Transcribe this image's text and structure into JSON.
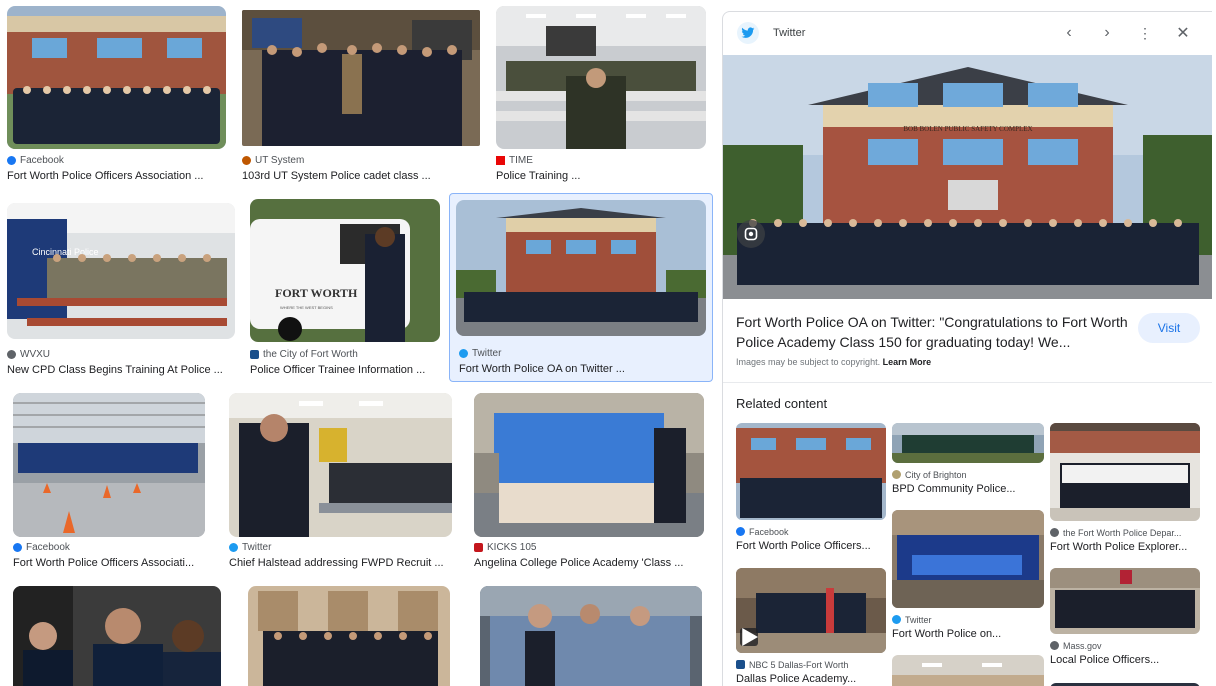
{
  "results": [
    {
      "source": "Facebook",
      "title": "Fort Worth Police Officers Association ...",
      "icon": "facebook-icon",
      "color": "#1877f2"
    },
    {
      "source": "UT System",
      "title": "103rd UT System Police cadet class ...",
      "icon": "ut-system-icon",
      "color": "#bf5700"
    },
    {
      "source": "TIME",
      "title": "Police Training ...",
      "icon": "time-icon",
      "color": "#e90606"
    },
    {
      "source": "WVXU",
      "title": "New CPD Class Begins Training At Police ...",
      "icon": "wvxu-icon",
      "color": "#5f6368"
    },
    {
      "source": "the City of Fort Worth",
      "title": "Police Officer Trainee Information ...",
      "icon": "city-fort-worth-icon",
      "color": "#1a4f8b"
    },
    {
      "source": "Twitter",
      "title": "Fort Worth Police OA on Twitter ...",
      "icon": "twitter-icon",
      "color": "#1d9bf0"
    },
    {
      "source": "Facebook",
      "title": "Fort Worth Police Officers Associati...",
      "icon": "facebook-icon",
      "color": "#1877f2"
    },
    {
      "source": "Twitter",
      "title": "Chief Halstead addressing FWPD Recruit ...",
      "icon": "twitter-icon",
      "color": "#1d9bf0"
    },
    {
      "source": "KICKS 105",
      "title": "Angelina College Police Academy 'Class ...",
      "icon": "kicks105-icon",
      "color": "#c4161c"
    },
    {
      "source": "",
      "title": "",
      "icon": "",
      "color": "#ffffff"
    },
    {
      "source": "",
      "title": "",
      "icon": "",
      "color": "#ffffff"
    },
    {
      "source": "",
      "title": "",
      "icon": "",
      "color": "#ffffff"
    }
  ],
  "panel": {
    "source": "Twitter",
    "title": "Fort Worth Police OA on Twitter: \"Congratulations to Fort Worth Police Academy Class 150 for graduating today! We...",
    "visit_label": "Visit",
    "copyright_text": "Images may be subject to copyright.",
    "learn_more": "Learn More",
    "related_heading": "Related content",
    "building_sign": "BOB BOLEN PUBLIC SAFETY COMPLEX"
  },
  "related": [
    {
      "source": "Facebook",
      "title": "Fort Worth Police Officers...",
      "icon": "facebook-icon",
      "color": "#1877f2"
    },
    {
      "source": "City of Brighton",
      "title": "BPD Community Police...",
      "icon": "brighton-icon",
      "color": "#b0a070"
    },
    {
      "source": "the Fort Worth Police Depar...",
      "title": "Fort Worth Police Explorer...",
      "icon": "fwpd-icon",
      "color": "#5f6368"
    },
    {
      "source": "NBC 5 Dallas-Fort Worth",
      "title": "Dallas Police Academy...",
      "icon": "nbc5-icon",
      "color": "#1a4f8b"
    },
    {
      "source": "Twitter",
      "title": "Fort Worth Police on...",
      "icon": "twitter-icon",
      "color": "#1d9bf0"
    },
    {
      "source": "Mass.gov",
      "title": "Local Police Officers...",
      "icon": "massgov-icon",
      "color": "#5f6368"
    },
    {
      "source": "",
      "title": "",
      "icon": "",
      "color": "#ffffff"
    }
  ],
  "thumb_text": {
    "fort_worth_logo": "FORT WORTH",
    "fort_worth_slogan": "WHERE THE WEST BEGINS",
    "cincinnati_sign": "Cincinnati Police"
  }
}
